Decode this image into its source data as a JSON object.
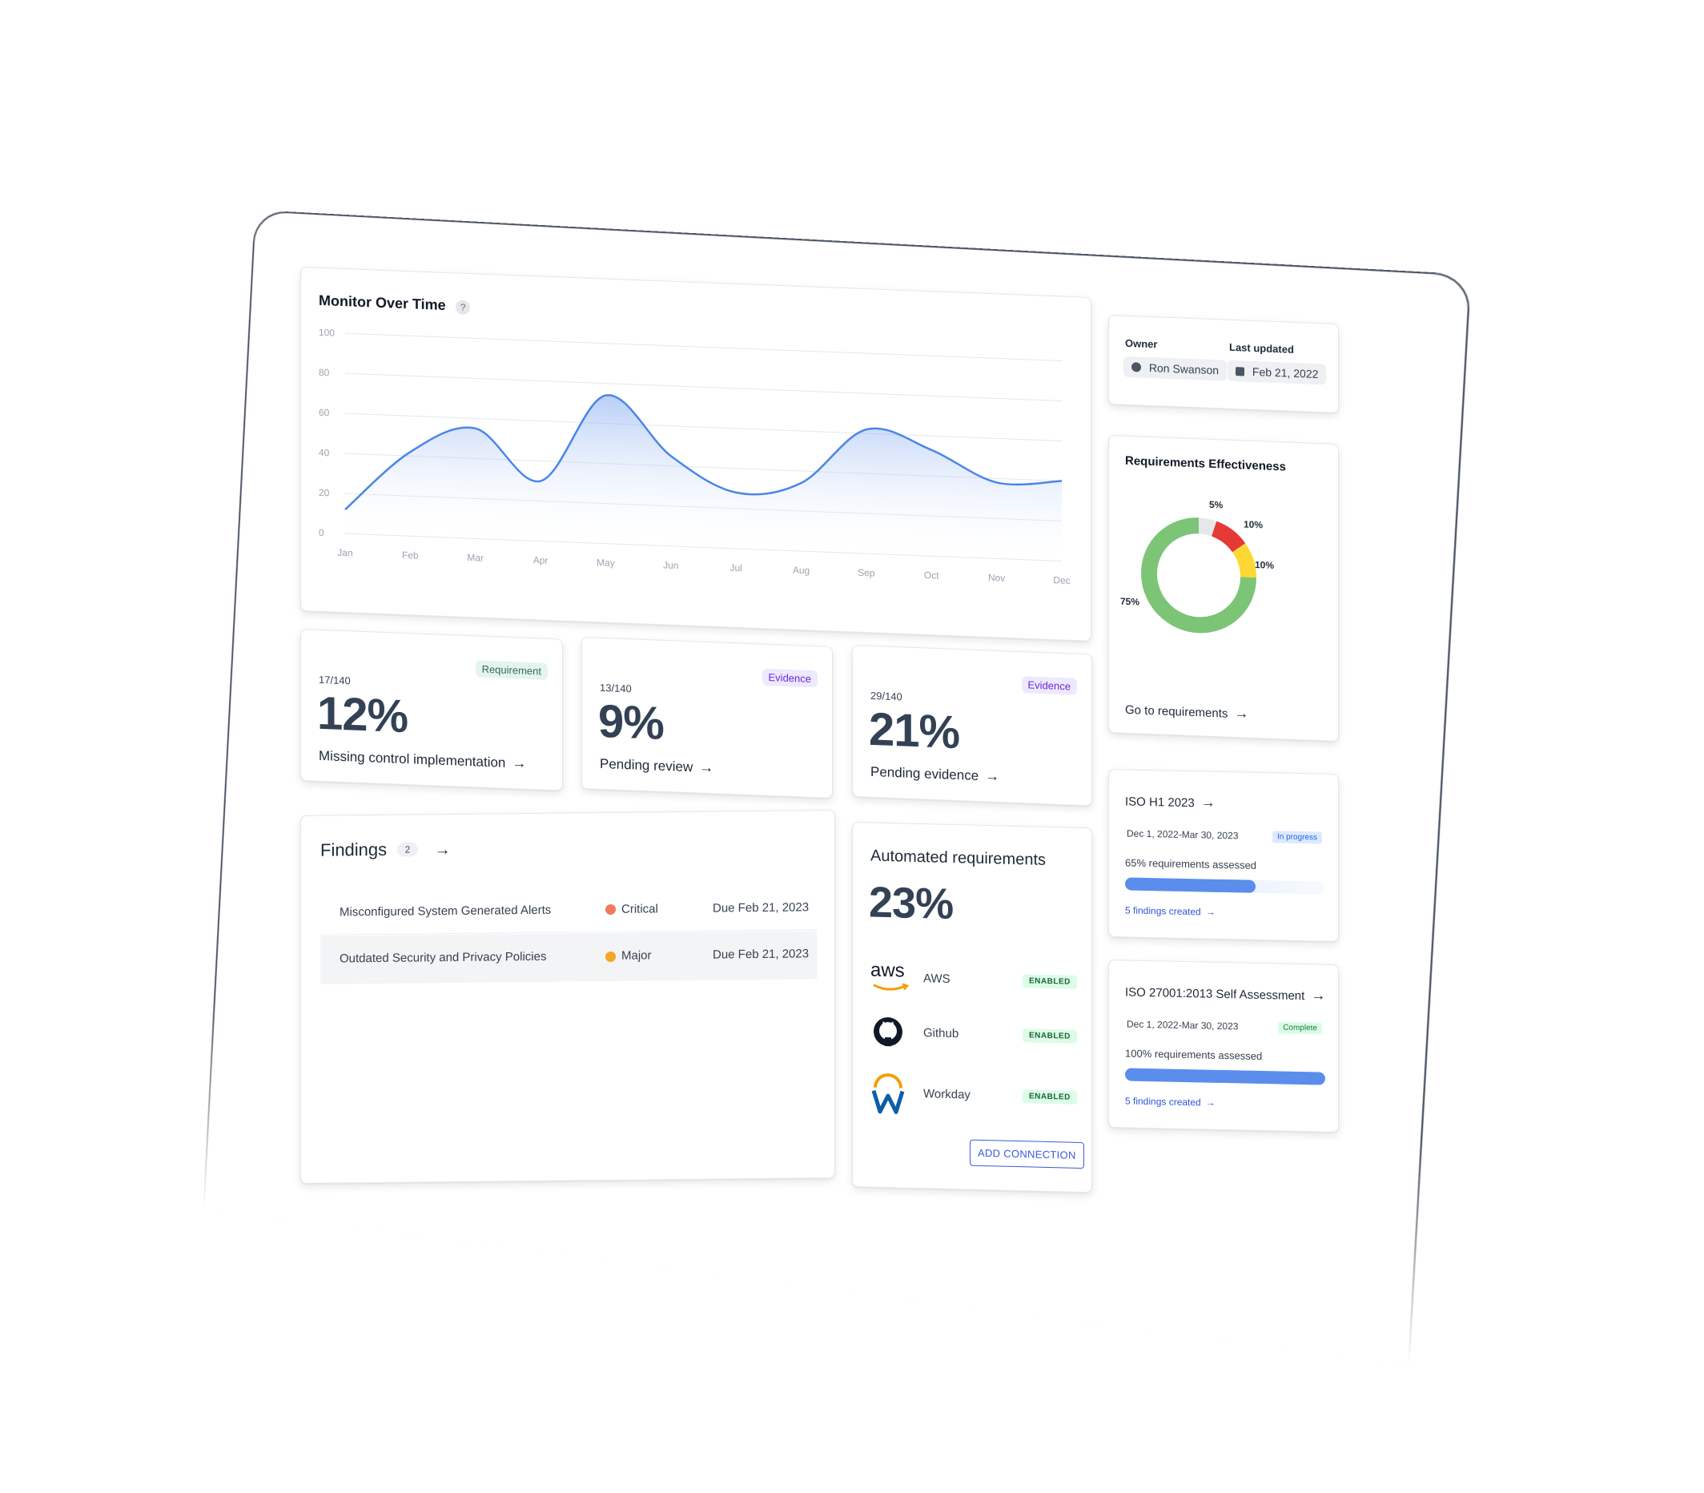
{
  "monitor": {
    "title": "Monitor Over Time",
    "help_icon": "?",
    "y_ticks": [
      "100",
      "80",
      "60",
      "40",
      "20",
      "0"
    ],
    "x_ticks": [
      "Jan",
      "Feb",
      "Mar",
      "Apr",
      "May",
      "Jun",
      "Jul",
      "Aug",
      "Sep",
      "Oct",
      "Nov",
      "Dec"
    ],
    "line_color": "#4a86e8"
  },
  "chart_data": {
    "type": "area",
    "title": "Monitor Over Time",
    "categories": [
      "Jan",
      "Feb",
      "Mar",
      "Apr",
      "May",
      "Jun",
      "Jul",
      "Aug",
      "Sep",
      "Oct",
      "Nov",
      "Dec"
    ],
    "series": [
      {
        "values": [
          12,
          42,
          55,
          30,
          74,
          45,
          28,
          34,
          62,
          53,
          38,
          40
        ]
      }
    ],
    "ylim": [
      0,
      100
    ],
    "grid": true
  },
  "owner": {
    "owner_label": "Owner",
    "owner_name": "Ron Swanson",
    "updated_label": "Last updated",
    "updated_date": "Feb 21, 2022"
  },
  "effectiveness": {
    "title": "Requirements Effectiveness",
    "link": "Go to requirements",
    "segments": [
      {
        "label": "75%",
        "value": 75,
        "color": "#7cc576"
      },
      {
        "label": "5%",
        "value": 5,
        "color": "#e5e7eb"
      },
      {
        "label": "10%",
        "value": 10,
        "color": "#e53935"
      },
      {
        "label": "10%",
        "value": 10,
        "color": "#fdd835"
      }
    ]
  },
  "stats": [
    {
      "badge": "Requirement",
      "frac": "17/140",
      "pct": "12%",
      "label": "Missing control implementation"
    },
    {
      "badge": "Evidence",
      "frac": "13/140",
      "pct": "9%",
      "label": "Pending review"
    },
    {
      "badge": "Evidence",
      "frac": "29/140",
      "pct": "21%",
      "label": "Pending evidence"
    }
  ],
  "findings": {
    "title": "Findings",
    "count": "2",
    "rows": [
      {
        "name": "Misconfigured System Generated Alerts",
        "severity": "Critical",
        "severity_color": "#ef7b5b",
        "due": "Due Feb 21, 2023"
      },
      {
        "name": "Outdated Security and Privacy Policies",
        "severity": "Major",
        "severity_color": "#f5a524",
        "due": "Due Feb 21, 2023"
      }
    ]
  },
  "automated": {
    "title": "Automated requirements",
    "pct": "23%",
    "integrations": [
      {
        "logo": "aws",
        "name": "AWS",
        "status": "ENABLED"
      },
      {
        "name": "Github",
        "status": "ENABLED"
      },
      {
        "name": "Workday",
        "status": "ENABLED"
      }
    ],
    "add_button": "ADD CONNECTION"
  },
  "audits": [
    {
      "title": "ISO H1 2023",
      "dates": "Dec 1, 2022-Mar 30, 2023",
      "status": "In progress",
      "status_bg": "#dbeafe",
      "status_color": "#2563eb",
      "assessed": "65% requirements assessed",
      "progress": 0.65,
      "findings": "5 findings created"
    },
    {
      "title": "ISO 27001:2013 Self Assessment",
      "dates": "Dec 1, 2022-Mar 30, 2023",
      "status": "Complete",
      "status_bg": "#dcfce7",
      "status_color": "#15803d",
      "assessed": "100% requirements assessed",
      "progress": 1.0,
      "findings": "5 findings created"
    }
  ]
}
